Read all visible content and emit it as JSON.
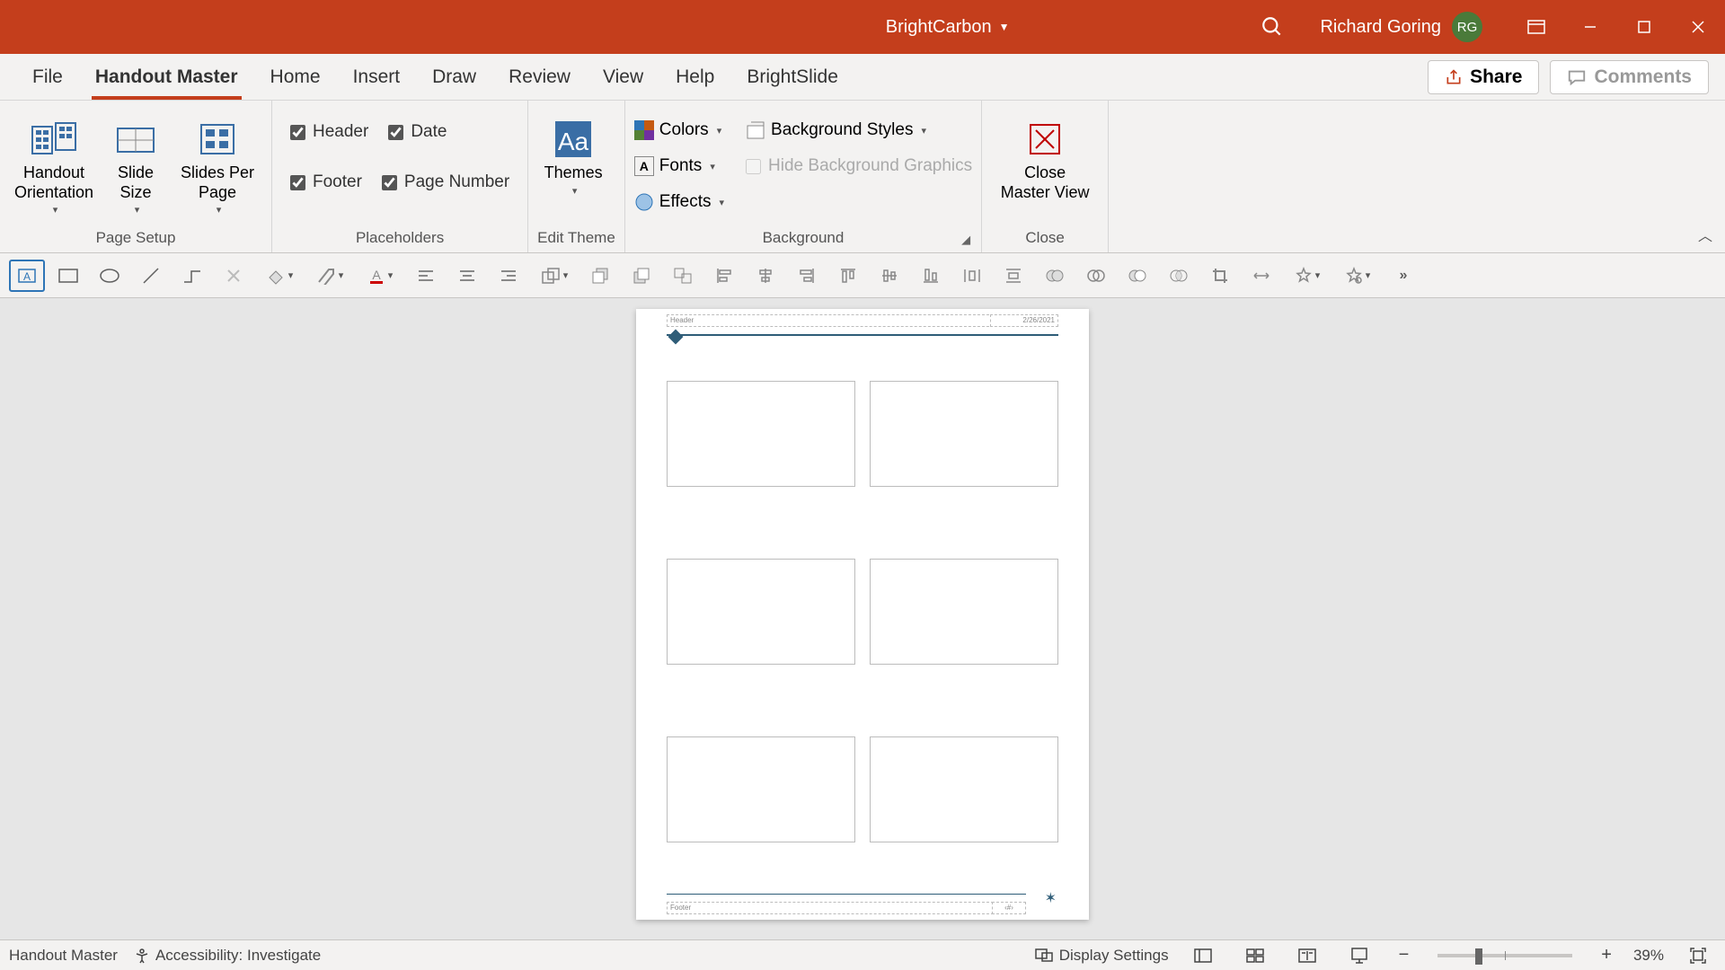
{
  "title": "BrightCarbon",
  "user": {
    "name": "Richard Goring",
    "initials": "RG"
  },
  "tabs": {
    "file": "File",
    "handout_master": "Handout Master",
    "home": "Home",
    "insert": "Insert",
    "draw": "Draw",
    "review": "Review",
    "view": "View",
    "help": "Help",
    "brightslide": "BrightSlide"
  },
  "share": "Share",
  "comments": "Comments",
  "ribbon": {
    "page_setup": {
      "label": "Page Setup",
      "handout_orientation": "Handout\nOrientation",
      "slide_size": "Slide\nSize",
      "slides_per_page": "Slides Per\nPage"
    },
    "placeholders": {
      "label": "Placeholders",
      "header": "Header",
      "date": "Date",
      "footer": "Footer",
      "page_number": "Page Number"
    },
    "edit_theme": {
      "label": "Edit Theme",
      "themes": "Themes"
    },
    "background": {
      "label": "Background",
      "colors": "Colors",
      "fonts": "Fonts",
      "effects": "Effects",
      "background_styles": "Background Styles",
      "hide_bg": "Hide Background Graphics"
    },
    "close": {
      "label": "Close",
      "close_master": "Close\nMaster View"
    }
  },
  "handout": {
    "header_text": "Header",
    "date_text": "2/26/2021",
    "footer_text": "Footer",
    "page_num_text": "‹#›"
  },
  "status": {
    "view_mode": "Handout Master",
    "accessibility": "Accessibility: Investigate",
    "display_settings": "Display Settings",
    "zoom": "39%"
  }
}
